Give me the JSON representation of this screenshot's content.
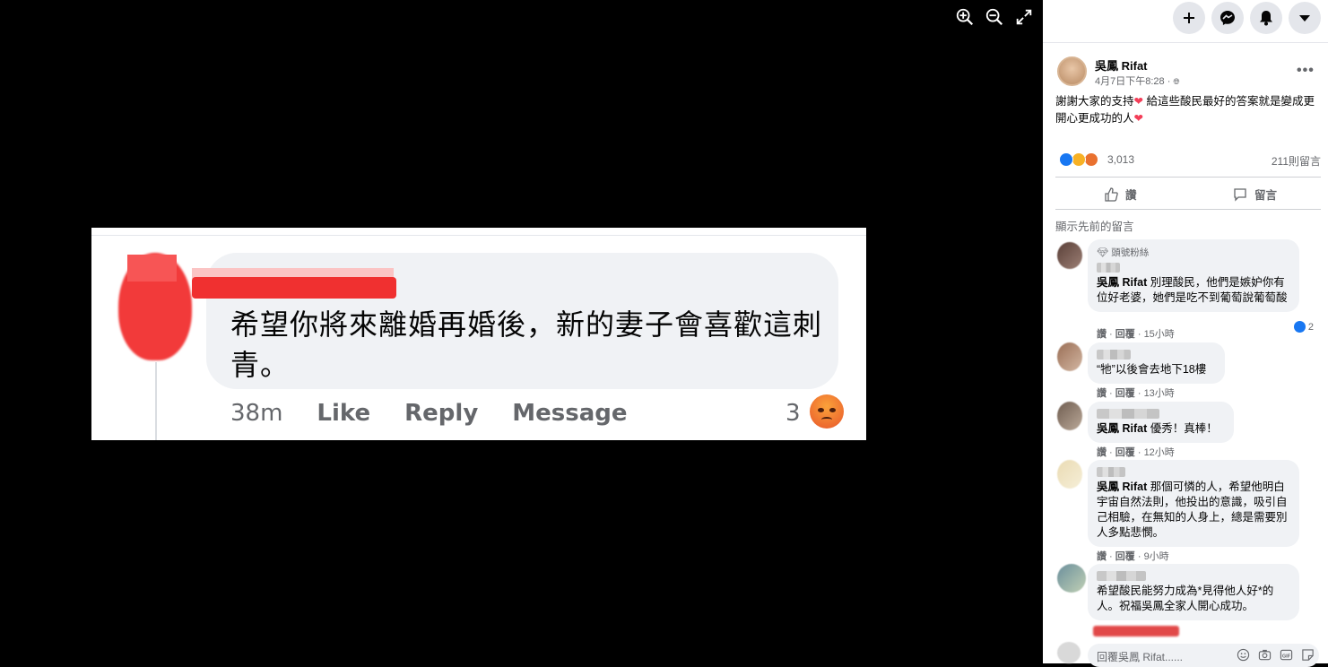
{
  "viewer": {
    "tools": [
      "zoom-in-icon",
      "zoom-out-icon",
      "fullscreen-icon"
    ],
    "photo": {
      "comment_text": "希望你將來離婚再婚後，新的妻子會喜歡這刺青。",
      "time": "38m",
      "like": "Like",
      "reply": "Reply",
      "message": "Message",
      "reaction_count": "3"
    }
  },
  "topbar": {
    "icons": [
      "plus-icon",
      "messenger-icon",
      "bell-icon",
      "caret-down-icon"
    ]
  },
  "post": {
    "author": "吳鳳 Rifat",
    "time": "4月7日下午8:28 · ",
    "text_1": "謝謝大家的支持",
    "text_2": " 給這些酸民最好的答案就是變成更開心更成功的人",
    "heart": "❤",
    "reaction_count": "3,013",
    "comment_count": "211則留言",
    "like_label": "讚",
    "comment_label": "留言"
  },
  "comments": {
    "previous": "顯示先前的留言",
    "c1": {
      "badge": "頭號粉絲",
      "author": "吳鳳 Rifat",
      "text": " 別理酸民，他們是嫉妒你有位好老婆，她們是吃不到葡萄說葡萄酸",
      "like": "讚",
      "reply": "回覆",
      "time": "15小時",
      "likes": "2"
    },
    "c2": {
      "text": "“牠”以後會去地下18樓",
      "like": "讚",
      "reply": "回覆",
      "time": "13小時"
    },
    "c3": {
      "author": "吳鳳 Rifat",
      "text": " 優秀！真棒！",
      "like": "讚",
      "reply": "回覆",
      "time": "12小時"
    },
    "c4": {
      "author": "吳鳳 Rifat",
      "text": " 那個可憐的人，希望他明白宇宙自然法則，他投出的意識，吸引自己相驗，在無知的人身上，總是需要別人多點悲憫。",
      "like": "讚",
      "reply": "回覆",
      "time": "9小時"
    },
    "c5": {
      "text": "希望酸民能努力成為*見得他人好*的人。祝福吳鳳全家人開心成功。"
    },
    "reply_placeholder": "回覆吳鳳 Rifat......"
  },
  "colors": {
    "accent": "#1877f2",
    "heart": "#f33e58",
    "bubble": "#f0f2f5"
  }
}
